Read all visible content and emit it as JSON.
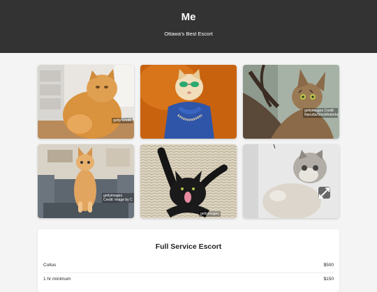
{
  "header": {
    "title": "Me",
    "subtitle": "Ottawa's Best Escort"
  },
  "gallery": {
    "photos": [
      {
        "watermark": "getty Credit"
      },
      {
        "watermark": ""
      },
      {
        "watermark": "gettyimages Credit: Nanutta/Stockfinderby"
      },
      {
        "watermark": "gettyimages Credit: Image by C"
      },
      {
        "watermark": "gettyimages"
      },
      {
        "watermark": ""
      }
    ],
    "expand_icon": "expand-icon"
  },
  "services": {
    "title": "Full Service Escort",
    "rows": [
      {
        "label": "Coitus",
        "price": "$500"
      },
      {
        "label": "1 hr minimum",
        "price": "$150"
      }
    ]
  },
  "colors": {
    "header_bg": "#333333",
    "page_bg": "#f4f4f4",
    "card_bg": "#ffffff"
  }
}
